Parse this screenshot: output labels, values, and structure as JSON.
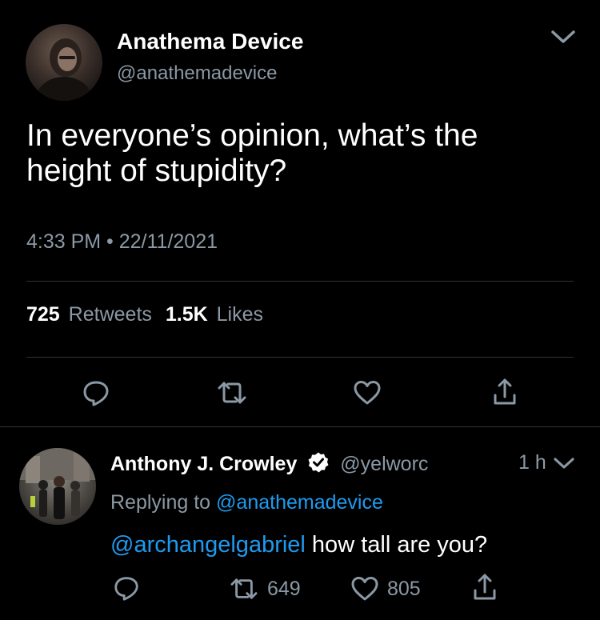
{
  "tweet": {
    "author_name": "Anathema Device",
    "author_handle": "@anathemadevice",
    "text_line1": "In everyone’s opinion, what’s the",
    "text_line2": "height of stupidity?",
    "timestamp": "4:33 PM • 22/11/2021",
    "retweet_count": "725",
    "retweet_label": "Retweets",
    "like_count": "1.5K",
    "like_label": "Likes"
  },
  "reply": {
    "author_name": "Anthony J. Crowley",
    "author_handle": "@yelworc",
    "time": "1 h",
    "replying_prefix": "Replying to",
    "replying_handle": "@anathemadevice",
    "mention": "@archangelgabriel",
    "text": " how tall are you?",
    "retweet_count": "649",
    "like_count": "805"
  },
  "colors": {
    "background": "#000000",
    "text": "#ffffff",
    "muted": "#8b98a5",
    "link": "#1d9bf0",
    "divider": "#2f3336"
  },
  "icons": {
    "tweet_actions": [
      "reply-icon",
      "retweet-icon",
      "like-icon",
      "share-icon"
    ],
    "reply_actions": [
      "reply-icon",
      "retweet-icon",
      "like-icon",
      "share-icon"
    ],
    "verified": "verified-badge-icon",
    "more": "chevron-down-icon"
  }
}
